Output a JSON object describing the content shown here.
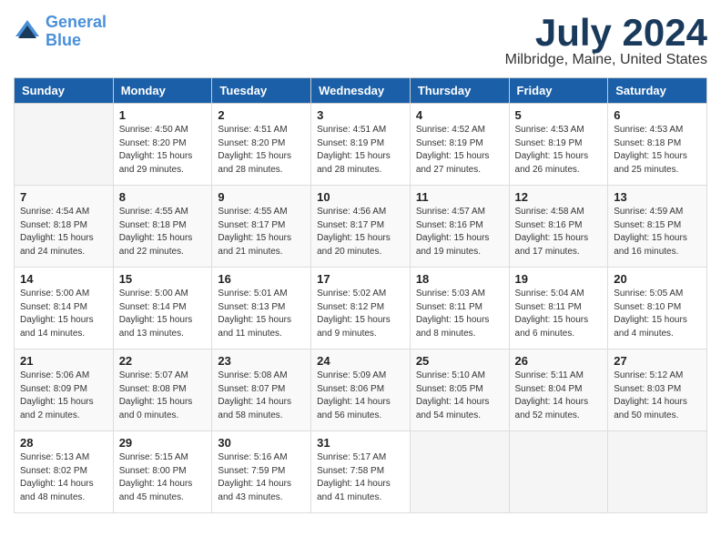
{
  "header": {
    "logo_line1": "General",
    "logo_line2": "Blue",
    "month": "July 2024",
    "location": "Milbridge, Maine, United States"
  },
  "weekdays": [
    "Sunday",
    "Monday",
    "Tuesday",
    "Wednesday",
    "Thursday",
    "Friday",
    "Saturday"
  ],
  "weeks": [
    [
      {
        "day": "",
        "info": ""
      },
      {
        "day": "1",
        "info": "Sunrise: 4:50 AM\nSunset: 8:20 PM\nDaylight: 15 hours\nand 29 minutes."
      },
      {
        "day": "2",
        "info": "Sunrise: 4:51 AM\nSunset: 8:20 PM\nDaylight: 15 hours\nand 28 minutes."
      },
      {
        "day": "3",
        "info": "Sunrise: 4:51 AM\nSunset: 8:19 PM\nDaylight: 15 hours\nand 28 minutes."
      },
      {
        "day": "4",
        "info": "Sunrise: 4:52 AM\nSunset: 8:19 PM\nDaylight: 15 hours\nand 27 minutes."
      },
      {
        "day": "5",
        "info": "Sunrise: 4:53 AM\nSunset: 8:19 PM\nDaylight: 15 hours\nand 26 minutes."
      },
      {
        "day": "6",
        "info": "Sunrise: 4:53 AM\nSunset: 8:18 PM\nDaylight: 15 hours\nand 25 minutes."
      }
    ],
    [
      {
        "day": "7",
        "info": "Sunrise: 4:54 AM\nSunset: 8:18 PM\nDaylight: 15 hours\nand 24 minutes."
      },
      {
        "day": "8",
        "info": "Sunrise: 4:55 AM\nSunset: 8:18 PM\nDaylight: 15 hours\nand 22 minutes."
      },
      {
        "day": "9",
        "info": "Sunrise: 4:55 AM\nSunset: 8:17 PM\nDaylight: 15 hours\nand 21 minutes."
      },
      {
        "day": "10",
        "info": "Sunrise: 4:56 AM\nSunset: 8:17 PM\nDaylight: 15 hours\nand 20 minutes."
      },
      {
        "day": "11",
        "info": "Sunrise: 4:57 AM\nSunset: 8:16 PM\nDaylight: 15 hours\nand 19 minutes."
      },
      {
        "day": "12",
        "info": "Sunrise: 4:58 AM\nSunset: 8:16 PM\nDaylight: 15 hours\nand 17 minutes."
      },
      {
        "day": "13",
        "info": "Sunrise: 4:59 AM\nSunset: 8:15 PM\nDaylight: 15 hours\nand 16 minutes."
      }
    ],
    [
      {
        "day": "14",
        "info": "Sunrise: 5:00 AM\nSunset: 8:14 PM\nDaylight: 15 hours\nand 14 minutes."
      },
      {
        "day": "15",
        "info": "Sunrise: 5:00 AM\nSunset: 8:14 PM\nDaylight: 15 hours\nand 13 minutes."
      },
      {
        "day": "16",
        "info": "Sunrise: 5:01 AM\nSunset: 8:13 PM\nDaylight: 15 hours\nand 11 minutes."
      },
      {
        "day": "17",
        "info": "Sunrise: 5:02 AM\nSunset: 8:12 PM\nDaylight: 15 hours\nand 9 minutes."
      },
      {
        "day": "18",
        "info": "Sunrise: 5:03 AM\nSunset: 8:11 PM\nDaylight: 15 hours\nand 8 minutes."
      },
      {
        "day": "19",
        "info": "Sunrise: 5:04 AM\nSunset: 8:11 PM\nDaylight: 15 hours\nand 6 minutes."
      },
      {
        "day": "20",
        "info": "Sunrise: 5:05 AM\nSunset: 8:10 PM\nDaylight: 15 hours\nand 4 minutes."
      }
    ],
    [
      {
        "day": "21",
        "info": "Sunrise: 5:06 AM\nSunset: 8:09 PM\nDaylight: 15 hours\nand 2 minutes."
      },
      {
        "day": "22",
        "info": "Sunrise: 5:07 AM\nSunset: 8:08 PM\nDaylight: 15 hours\nand 0 minutes."
      },
      {
        "day": "23",
        "info": "Sunrise: 5:08 AM\nSunset: 8:07 PM\nDaylight: 14 hours\nand 58 minutes."
      },
      {
        "day": "24",
        "info": "Sunrise: 5:09 AM\nSunset: 8:06 PM\nDaylight: 14 hours\nand 56 minutes."
      },
      {
        "day": "25",
        "info": "Sunrise: 5:10 AM\nSunset: 8:05 PM\nDaylight: 14 hours\nand 54 minutes."
      },
      {
        "day": "26",
        "info": "Sunrise: 5:11 AM\nSunset: 8:04 PM\nDaylight: 14 hours\nand 52 minutes."
      },
      {
        "day": "27",
        "info": "Sunrise: 5:12 AM\nSunset: 8:03 PM\nDaylight: 14 hours\nand 50 minutes."
      }
    ],
    [
      {
        "day": "28",
        "info": "Sunrise: 5:13 AM\nSunset: 8:02 PM\nDaylight: 14 hours\nand 48 minutes."
      },
      {
        "day": "29",
        "info": "Sunrise: 5:15 AM\nSunset: 8:00 PM\nDaylight: 14 hours\nand 45 minutes."
      },
      {
        "day": "30",
        "info": "Sunrise: 5:16 AM\nSunset: 7:59 PM\nDaylight: 14 hours\nand 43 minutes."
      },
      {
        "day": "31",
        "info": "Sunrise: 5:17 AM\nSunset: 7:58 PM\nDaylight: 14 hours\nand 41 minutes."
      },
      {
        "day": "",
        "info": ""
      },
      {
        "day": "",
        "info": ""
      },
      {
        "day": "",
        "info": ""
      }
    ]
  ]
}
